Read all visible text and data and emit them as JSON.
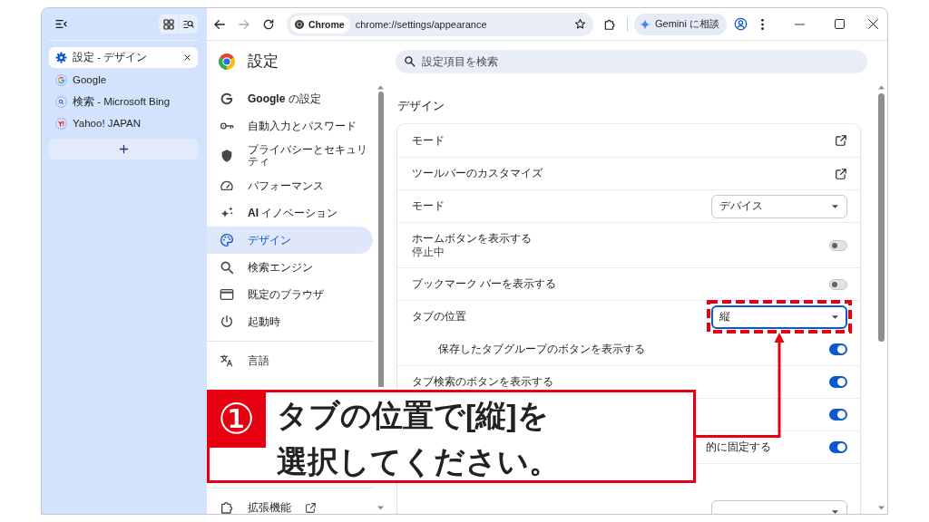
{
  "sidebar": {
    "tabs": [
      {
        "title": "設定 - デザイン",
        "selected": true,
        "discarded": false
      },
      {
        "title": "Google",
        "selected": false,
        "discarded": true
      },
      {
        "title": "検索 - Microsoft Bing",
        "selected": false,
        "discarded": true
      },
      {
        "title": "Yahoo! JAPAN",
        "selected": false,
        "discarded": true
      }
    ]
  },
  "toolbar": {
    "nav_buttons": [
      {
        "kind": "back",
        "disabled": false
      },
      {
        "kind": "forward",
        "disabled": true
      },
      {
        "kind": "reload",
        "disabled": false
      }
    ],
    "omnibox": {
      "chip": "Chrome",
      "url": "chrome://settings/appearance"
    },
    "gemini_button": "Gemini に相談"
  },
  "settings": {
    "title": "設定",
    "search": {
      "placeholder": "設定項目を検索"
    },
    "nav_groups": [
      {
        "items": [
          {
            "label": "**Google** の設定",
            "selected": false,
            "external": false
          },
          {
            "label": "自動入力とパスワード",
            "selected": false,
            "external": false
          },
          {
            "label": "プライバシーとセキュリティ",
            "selected": false,
            "external": false
          },
          {
            "label": "パフォーマンス",
            "selected": false,
            "external": false
          },
          {
            "label": "**AI** イノベーション",
            "selected": false,
            "external": false
          },
          {
            "label": "デザイン",
            "selected": true,
            "external": false
          },
          {
            "label": "検索エンジン",
            "selected": false,
            "external": false
          },
          {
            "label": "既定のブラウザ",
            "selected": false,
            "external": false
          },
          {
            "label": "起動時",
            "selected": false,
            "external": false
          }
        ]
      },
      {
        "items": [
          {
            "label": "言語",
            "selected": false,
            "external": false
          }
        ]
      },
      {
        "items": [
          {
            "label": "拡張機能",
            "selected": false,
            "external": true
          }
        ]
      }
    ],
    "section_title": "デザイン",
    "rows": [
      {
        "kind": "link",
        "label": "モード"
      },
      {
        "kind": "link",
        "label": "ツールバーのカスタマイズ"
      },
      {
        "kind": "select",
        "label": "モード",
        "value": "デバイス",
        "focused": false
      },
      {
        "kind": "toggle",
        "label": "ホームボタンを表示する",
        "sublabel": "停止中",
        "on": false
      },
      {
        "kind": "toggle",
        "label": "ブックマーク バーを表示する",
        "on": false
      },
      {
        "kind": "select",
        "label": "タブの位置",
        "value": "縦",
        "focused": true
      },
      {
        "kind": "subtoggle",
        "label": "保存したタブグループのボタンを表示する",
        "on": true
      },
      {
        "kind": "toggle",
        "label": "タブ検索のボタンを表示する",
        "on": true
      },
      {
        "kind": "toggle",
        "on": true
      },
      {
        "kind": "tail-toggle",
        "label": "的に固定する",
        "on": true
      },
      {
        "kind": "heading"
      },
      {
        "kind": "subselect"
      }
    ]
  },
  "callout": {
    "number": "①",
    "lines": [
      "タブの位置で[縦]を",
      "選択してください。"
    ]
  }
}
